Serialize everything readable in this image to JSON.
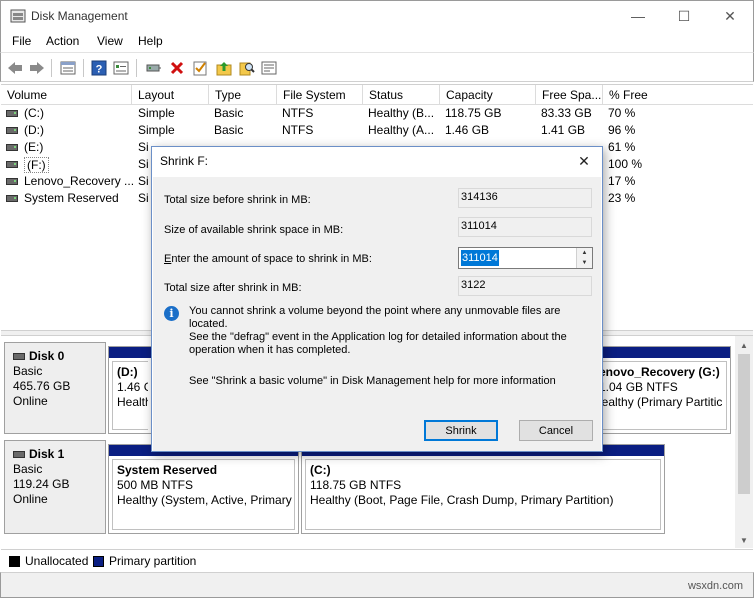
{
  "window": {
    "title": "Disk Management",
    "minimize": "—",
    "maximize": "☐",
    "close": "✕"
  },
  "menu": [
    "File",
    "Action",
    "View",
    "Help"
  ],
  "columns": [
    "Volume",
    "Layout",
    "Type",
    "File System",
    "Status",
    "Capacity",
    "Free Spa...",
    "% Free"
  ],
  "volumes": [
    {
      "volume": "(C:)",
      "layout": "Simple",
      "type": "Basic",
      "fs": "NTFS",
      "status": "Healthy (B...",
      "capacity": "118.75 GB",
      "free": "83.33 GB",
      "pct": "70 %"
    },
    {
      "volume": "(D:)",
      "layout": "Simple",
      "type": "Basic",
      "fs": "NTFS",
      "status": "Healthy (A...",
      "capacity": "1.46 GB",
      "free": "1.41 GB",
      "pct": "96 %"
    },
    {
      "volume": "(E:)",
      "layout": "Si",
      "type": "",
      "fs": "",
      "status": "",
      "capacity": "",
      "free": "",
      "pct": "61 %"
    },
    {
      "volume": "(F:)",
      "layout": "Si",
      "type": "",
      "fs": "",
      "status": "",
      "capacity": "",
      "free": "",
      "pct": "100 %"
    },
    {
      "volume": "Lenovo_Recovery ...",
      "layout": "Si",
      "type": "",
      "fs": "",
      "status": "",
      "capacity": "",
      "free": "",
      "pct": "17 %"
    },
    {
      "volume": "System Reserved",
      "layout": "Si",
      "type": "",
      "fs": "",
      "status": "",
      "capacity": "",
      "free": "",
      "pct": "23 %"
    }
  ],
  "disks": [
    {
      "name": "Disk 0",
      "kind": "Basic",
      "size": "465.76 GB",
      "state": "Online",
      "partitions": [
        {
          "name": "(D:)",
          "size": "1.46 GB",
          "status": "Healthy"
        },
        {
          "name": "enovo_Recovery  (G:)",
          "size": "1.04 GB NTFS",
          "status": "lealthy (Primary Partitic"
        }
      ]
    },
    {
      "name": "Disk 1",
      "kind": "Basic",
      "size": "119.24 GB",
      "state": "Online",
      "partitions": [
        {
          "name": "System Reserved",
          "size": "500 MB NTFS",
          "status": "Healthy (System, Active, Primary I"
        },
        {
          "name": "(C:)",
          "size": "118.75 GB NTFS",
          "status": "Healthy (Boot, Page File, Crash Dump, Primary Partition)"
        }
      ]
    }
  ],
  "legend": [
    {
      "label": "Unallocated",
      "color": "#000000"
    },
    {
      "label": "Primary partition",
      "color": "#0a1e82"
    }
  ],
  "dialog": {
    "title": "Shrink F:",
    "close": "✕",
    "total_before_label": "Total size before shrink in MB:",
    "total_before_value": "314136",
    "available_label": "Size of available shrink space in MB:",
    "available_value": "311014",
    "enter_label": "Enter the amount of space to shrink in MB:",
    "enter_value": "311014",
    "total_after_label": "Total size after shrink in MB:",
    "total_after_value": "3122",
    "info_line1": "You cannot shrink a volume beyond the point where any unmovable files are located.",
    "info_line2": "See the \"defrag\" event in the Application log for detailed information about the",
    "info_line3": "operation when it has completed.",
    "help": "See \"Shrink a basic volume\" in Disk Management help for more information",
    "shrink_label": "Shrink",
    "cancel_label": "Cancel"
  },
  "watermark": "wsxdn.com",
  "accent": "#0078d7"
}
